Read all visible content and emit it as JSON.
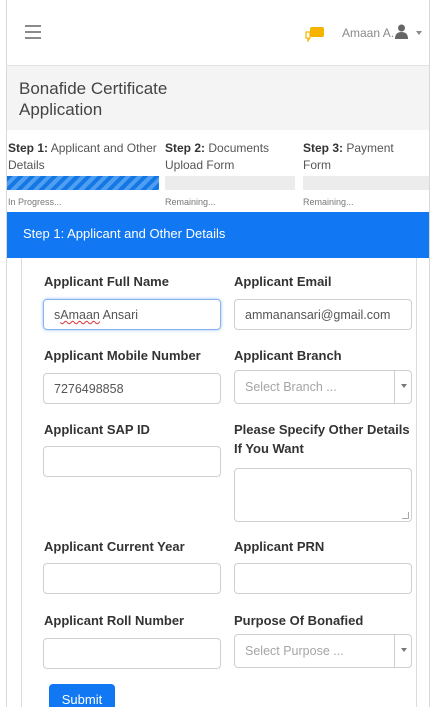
{
  "topbar": {
    "menu_icon": "hamburger-icon",
    "notification_icon": "chat-bubble-icon",
    "user_name": "Amaan A.",
    "user_icon": "user-icon",
    "dropdown_icon": "caret-down-icon",
    "accent": "#f6b400"
  },
  "page": {
    "title": "Bonafide Certificate Application"
  },
  "steps": [
    {
      "prefix": "Step 1:",
      "label": "Applicant and Other Details",
      "status": "In Progress...",
      "progress": 1.0
    },
    {
      "prefix": "Step 2:",
      "label": "Documents Upload Form",
      "status": "Remaining...",
      "progress": 0
    },
    {
      "prefix": "Step 3:",
      "label": "Payment Form",
      "status": "Remaining...",
      "progress": 0
    }
  ],
  "card": {
    "header": "Step 1: Applicant and Other Details",
    "header_color": "#1177f2"
  },
  "form": {
    "full_name_label": "Applicant Full Name",
    "full_name_value_prefix": "s",
    "full_name_value_word": "Amaan",
    "full_name_value_rest": " Ansari",
    "email_label": "Applicant Email",
    "email_value": "ammanansari@gmail.com",
    "mobile_label": "Applicant Mobile Number",
    "mobile_value": "7276498858",
    "branch_label": "Applicant Branch",
    "branch_placeholder": "Select Branch ...",
    "sap_label": "Applicant SAP ID",
    "sap_value": "",
    "other_label": "Please Specify Other Details If You Want",
    "other_value": "",
    "year_label": "Applicant Current Year",
    "year_value": "",
    "prn_label": "Applicant PRN",
    "prn_value": "",
    "roll_label": "Applicant Roll Number",
    "roll_value": "",
    "purpose_label": "Purpose Of Bonafied",
    "purpose_placeholder": "Select Purpose ...",
    "submit_label": "Submit"
  }
}
